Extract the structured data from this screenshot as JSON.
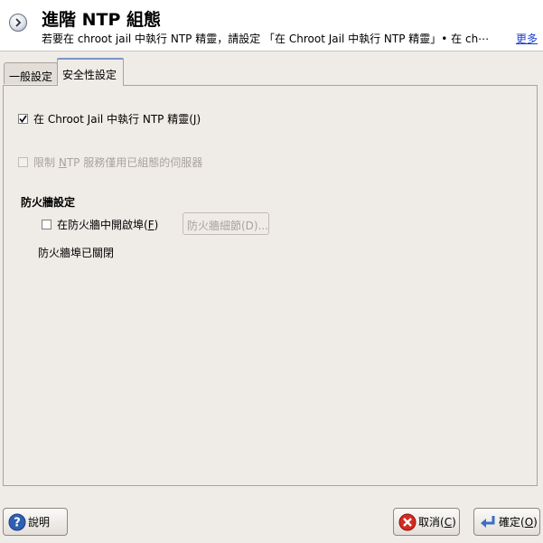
{
  "header": {
    "title": "進階 NTP 組態",
    "description": "若要在  chroot jail 中執行  NTP 精靈，請設定 「在  Chroot Jail 中執行  NTP 精靈」• 在  ch⋯",
    "more_link": "更多",
    "icon": "arrow-circle-icon"
  },
  "tabs": [
    {
      "label": "一般設定",
      "active": false
    },
    {
      "label": "安全性設定",
      "active": true
    }
  ],
  "security": {
    "chroot_prefix": "在  Chroot Jail 中執行  NTP 精靈(",
    "chroot_key": "J",
    "chroot_suffix": ")",
    "chroot_checked": true,
    "restrict_prefix": "限制  ",
    "restrict_key": "N",
    "restrict_suffix": "TP 服務僅用已組態的伺服器",
    "restrict_checked": false
  },
  "firewall": {
    "section_title": "防火牆設定",
    "open_port_prefix": "在防火牆中開啟埠(",
    "open_port_key": "F",
    "open_port_suffix": ")",
    "open_port_checked": false,
    "details_button": "防火牆細節(D)...",
    "status": "防火牆埠已關閉"
  },
  "buttons": {
    "help_prefix": "說明",
    "cancel_prefix": "取消(",
    "cancel_key": "C",
    "cancel_suffix": ")",
    "ok_prefix": "確定(",
    "ok_key": "O",
    "ok_suffix": ")"
  },
  "colors": {
    "background": "#efebe7",
    "link": "#1a3fcf",
    "tab_accent": "#7b95c7"
  }
}
